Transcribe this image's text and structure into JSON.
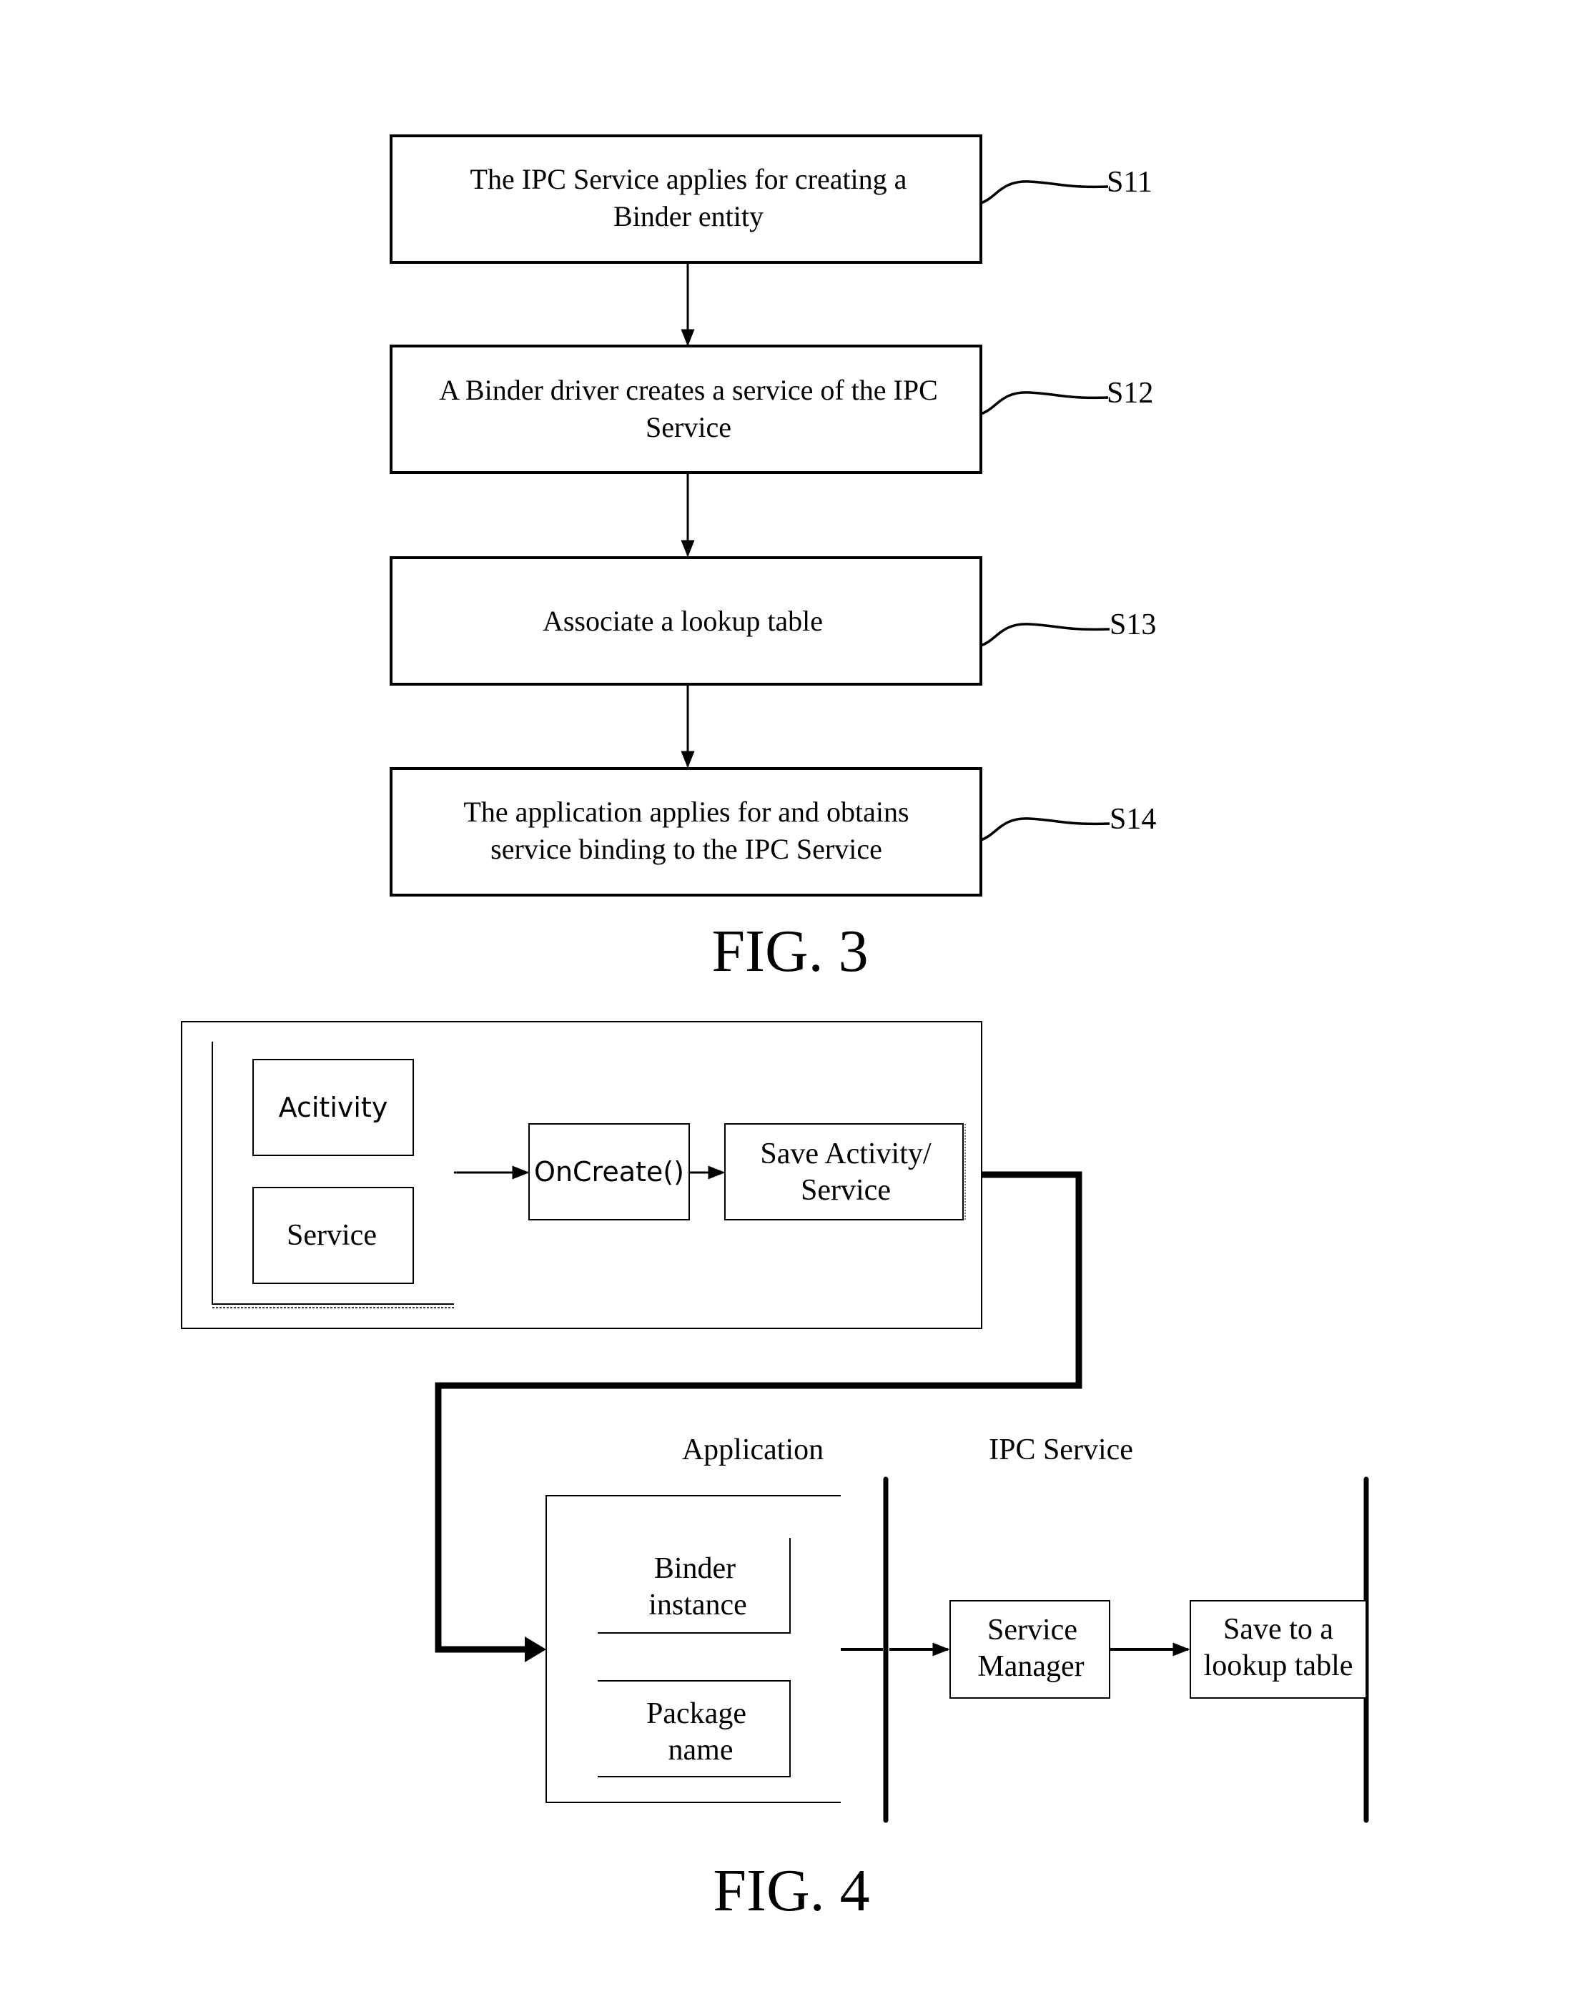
{
  "fig3": {
    "caption": "FIG. 3",
    "steps": [
      {
        "id": "S11",
        "lines": [
          "The IPC Service applies for creating a",
          "Binder entity"
        ]
      },
      {
        "id": "S12",
        "lines": [
          "A Binder driver creates a service of the IPC",
          "Service"
        ]
      },
      {
        "id": "S13",
        "lines": [
          "Associate a lookup table"
        ]
      },
      {
        "id": "S14",
        "lines": [
          "The application applies for and obtains",
          "service binding to the IPC Service"
        ]
      }
    ]
  },
  "fig4": {
    "caption": "FIG. 4",
    "components": {
      "activity": "Acitivity",
      "service": "Service",
      "oncreate": "OnCreate()",
      "save_activity": [
        "Save Activity/",
        "Service"
      ]
    },
    "lanes": {
      "application": "Application",
      "ipc_service": "IPC Service"
    },
    "app_items": {
      "binder_instance": [
        "Binder",
        "instance"
      ],
      "package_name": [
        "Package",
        "name"
      ]
    },
    "ipc_items": {
      "service_manager": [
        "Service",
        "Manager"
      ],
      "save_lookup": [
        "Save to a",
        "lookup table"
      ]
    }
  }
}
